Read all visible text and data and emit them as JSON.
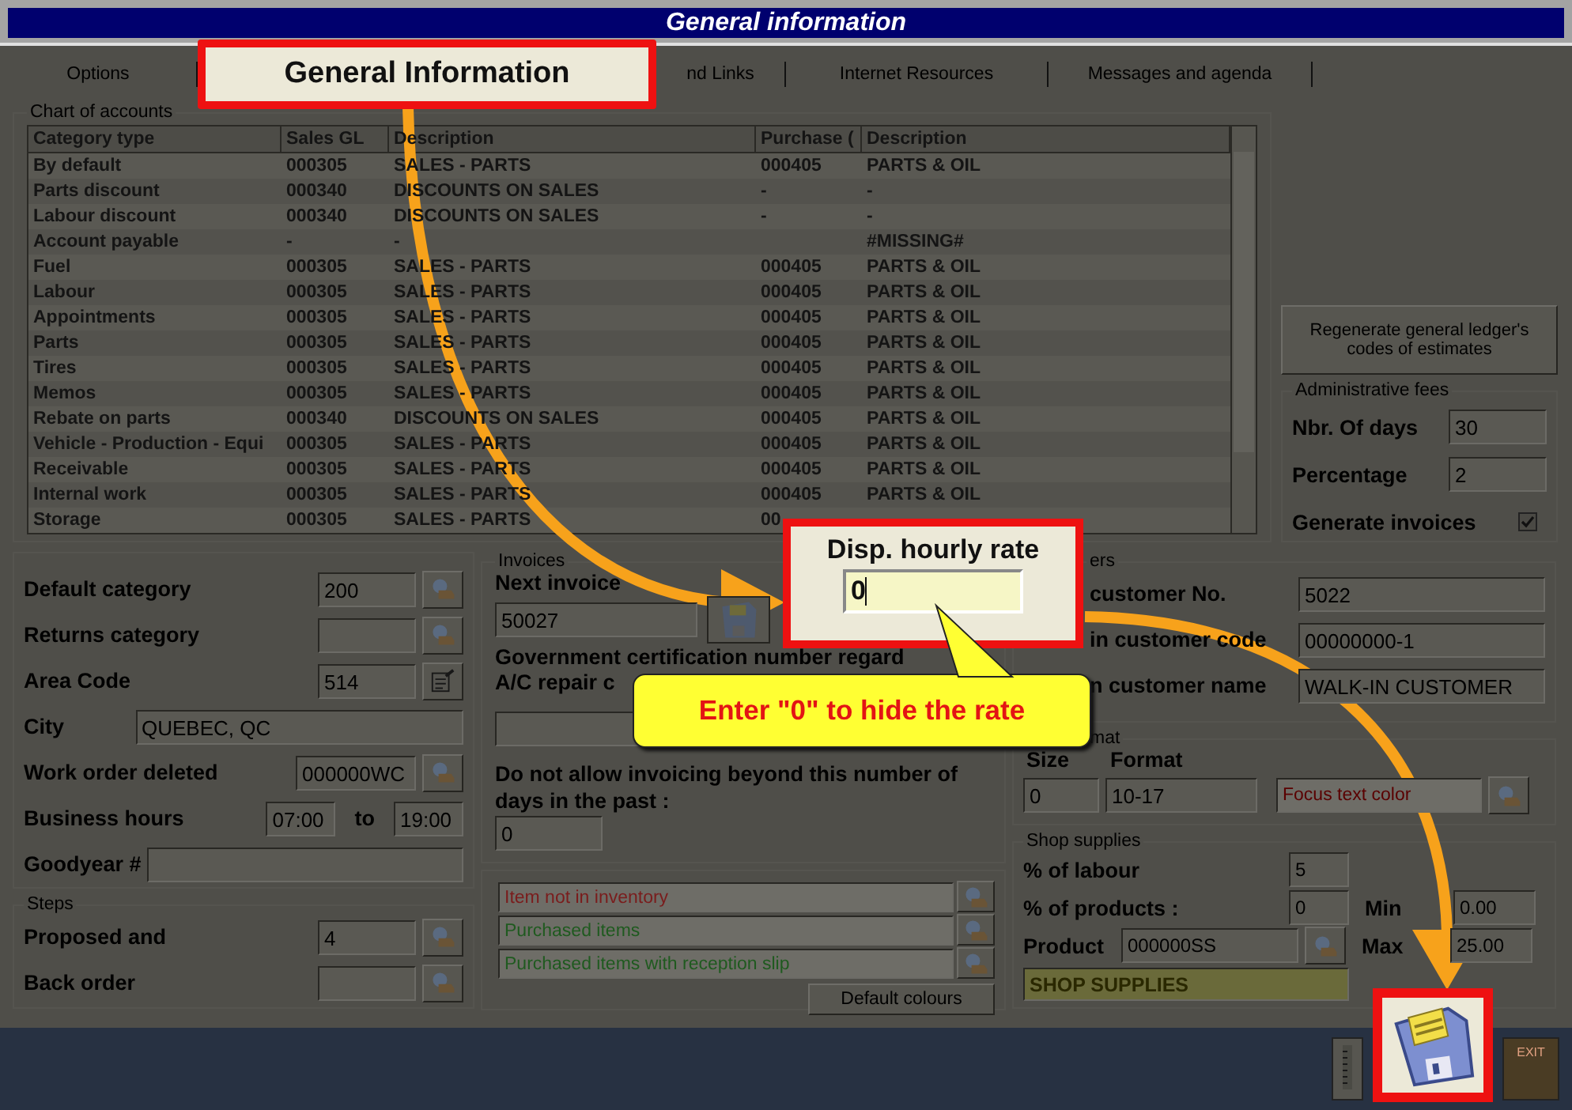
{
  "window": {
    "title": "General information"
  },
  "tabs": [
    {
      "label": "Options",
      "selected": false
    },
    {
      "label": "General Information",
      "selected": true
    },
    {
      "label": "nd Links",
      "selected": false
    },
    {
      "label": "Internet Resources",
      "selected": false
    },
    {
      "label": "Messages and agenda",
      "selected": false
    }
  ],
  "chart_of_accounts": {
    "legend": "Chart of accounts",
    "columns": [
      "Category type",
      "Sales GL",
      "Description",
      "Purchase (",
      "Description"
    ],
    "rows": [
      {
        "category": "By default",
        "sales_gl": "000305",
        "description": "SALES - PARTS",
        "purchase": "000405",
        "purchase_description": "PARTS & OIL"
      },
      {
        "category": "Parts discount",
        "sales_gl": "000340",
        "description": "DISCOUNTS ON SALES",
        "purchase": "-",
        "purchase_description": "-"
      },
      {
        "category": "Labour discount",
        "sales_gl": "000340",
        "description": "DISCOUNTS ON SALES",
        "purchase": "-",
        "purchase_description": "-"
      },
      {
        "category": "Account payable",
        "sales_gl": "-",
        "description": "-",
        "purchase_description": "#MISSING#"
      },
      {
        "category": "Fuel",
        "sales_gl": "000305",
        "description": "SALES - PARTS",
        "purchase": "000405",
        "purchase_description": "PARTS & OIL"
      },
      {
        "category": "Labour",
        "sales_gl": "000305",
        "description": "SALES - PARTS",
        "purchase": "000405",
        "purchase_description": "PARTS & OIL"
      },
      {
        "category": "Appointments",
        "sales_gl": "000305",
        "description": "SALES - PARTS",
        "purchase": "000405",
        "purchase_description": "PARTS & OIL"
      },
      {
        "category": "Parts",
        "sales_gl": "000305",
        "description": "SALES - PARTS",
        "purchase": "000405",
        "purchase_description": "PARTS & OIL"
      },
      {
        "category": "Tires",
        "sales_gl": "000305",
        "description": "SALES - PARTS",
        "purchase": "000405",
        "purchase_description": "PARTS & OIL"
      },
      {
        "category": "Memos",
        "sales_gl": "000305",
        "description": "SALES - PARTS",
        "purchase": "000405",
        "purchase_description": "PARTS & OIL"
      },
      {
        "category": "Rebate on parts",
        "sales_gl": "000340",
        "description": "DISCOUNTS ON SALES",
        "purchase": "000405",
        "purchase_description": "PARTS & OIL"
      },
      {
        "category": "Vehicle - Production - Equi",
        "sales_gl": "000305",
        "description": "SALES - PARTS",
        "purchase": "000405",
        "purchase_description": "PARTS & OIL"
      },
      {
        "category": "Receivable",
        "sales_gl": "000305",
        "description": "SALES - PARTS",
        "purchase": "000405",
        "purchase_description": "PARTS & OIL"
      },
      {
        "category": "Internal work",
        "sales_gl": "000305",
        "description": "SALES - PARTS",
        "purchase": "000405",
        "purchase_description": "PARTS & OIL"
      },
      {
        "category": "Storage",
        "sales_gl": "000305",
        "description": "SALES - PARTS",
        "purchase": "00"
      }
    ]
  },
  "regenerate_button": "Regenerate general ledger's codes of estimates",
  "administrative_fees": {
    "legend": "Administrative fees",
    "fields": [
      {
        "label": "Nbr. Of days",
        "value": "30"
      },
      {
        "label": "Percentage",
        "value": "2"
      }
    ],
    "generate_invoices": {
      "label": "Generate invoices",
      "checked": true
    }
  },
  "general": {
    "fields": [
      {
        "kind": "lookup",
        "label": "Default category",
        "value": "200"
      },
      {
        "kind": "lookup",
        "label": "Returns category"
      },
      {
        "kind": "edit",
        "label": "Area Code",
        "value": "514"
      },
      {
        "kind": "wide",
        "label": "City",
        "value": "QUEBEC, QC"
      },
      {
        "kind": "lookup_wide",
        "label": "Work order deleted",
        "value": "000000WC"
      },
      {
        "kind": "range",
        "label": "Business hours",
        "value": "07:00",
        "to_label": "to",
        "to_value": "19:00"
      },
      {
        "kind": "wide",
        "label": "Goodyear #"
      }
    ]
  },
  "steps": {
    "legend": "Steps",
    "fields": [
      {
        "label": "Proposed and",
        "value": "4"
      },
      {
        "label": "Back order"
      }
    ]
  },
  "invoices": {
    "legend": "Invoices",
    "next_invoice_label": "Next invoice",
    "next_invoice": "50027",
    "certification_label": "Government certification number regard",
    "repair_label": "A/C repair c",
    "days_label": "Do not allow invoicing beyond this number of days in the past :",
    "days_value": "0"
  },
  "colours": {
    "items": [
      {
        "label": "Item not in inventory",
        "color": "#7a1c1c"
      },
      {
        "label": "Purchased items",
        "color": "#1f5a1f"
      },
      {
        "label": "Purchased items with reception slip",
        "color": "#1f5a1f"
      }
    ],
    "default_button": "Default colours"
  },
  "customers": {
    "legend": "ers",
    "fields": [
      {
        "label": "customer No.",
        "value": "5022"
      },
      {
        "label": "in customer code",
        "value": "00000000-1"
      },
      {
        "label": "n customer name",
        "value": "WALK-IN CUSTOMER"
      }
    ]
  },
  "format": {
    "legend": "mat",
    "size_label": "Size",
    "format_label": "Format",
    "size": "0",
    "format": "10-17",
    "focus_label": "Focus text color"
  },
  "shop_supplies": {
    "legend": "Shop supplies",
    "labour_label": "% of labour",
    "labour": "5",
    "products_label": "% of products :",
    "products": "0",
    "min_label": "Min",
    "min": "0.00",
    "product_label": "Product",
    "product": "000000SS",
    "max_label": "Max",
    "max": "25.00",
    "description": "SHOP SUPPLIES"
  },
  "exit_label": "EXIT",
  "disp_callout": {
    "label": "Disp. hourly rate",
    "value": "0"
  },
  "tooltip": "Enter \"0\" to hide the rate"
}
